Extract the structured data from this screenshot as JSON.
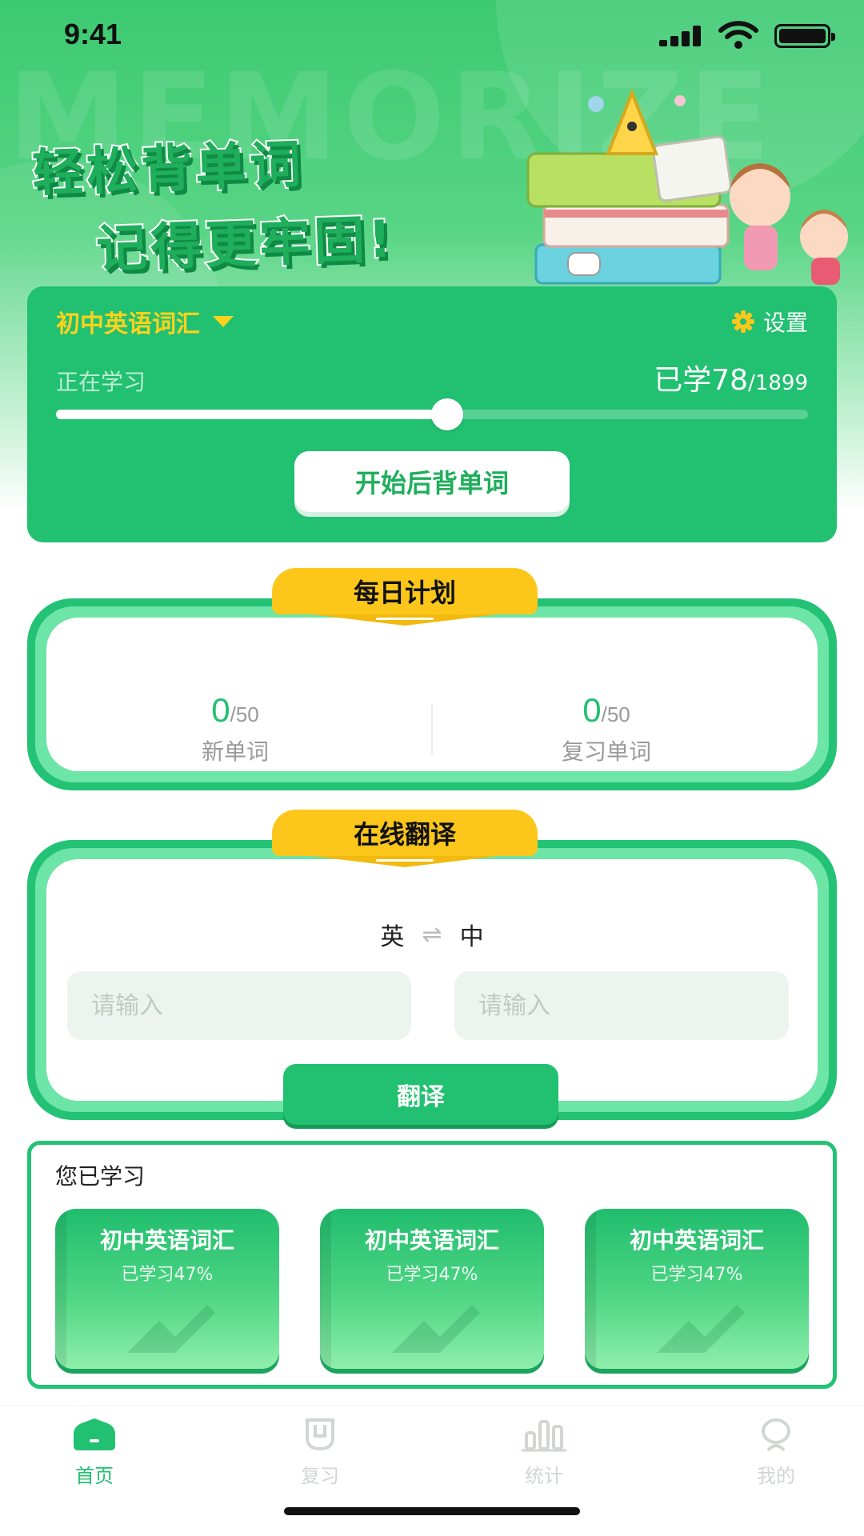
{
  "status_bar": {
    "time": "9:41"
  },
  "hero": {
    "watermark": "MEMORIZE",
    "slogan_line1": "轻松背单词",
    "slogan_line2": "记得更牢固!"
  },
  "vocab_card": {
    "book_name": "初中英语词汇",
    "settings_label": "设置",
    "studying_label": "正在学习",
    "learned_prefix": "已学",
    "learned_count": "78",
    "total_count": "/1899",
    "progress_fraction": 0.52,
    "start_button": "开始后背单词"
  },
  "daily_plan": {
    "title": "每日计划",
    "new_words": {
      "value": "0",
      "target": "/50",
      "label": "新单词"
    },
    "review_words": {
      "value": "0",
      "target": "/50",
      "label": "复习单词"
    }
  },
  "translate": {
    "title": "在线翻译",
    "source_lang": "英",
    "swap_symbol": "⇌",
    "target_lang": "中",
    "input_left_placeholder": "请输入",
    "input_right_placeholder": "请输入",
    "button": "翻译"
  },
  "learned_section": {
    "title": "您已学习",
    "books": [
      {
        "name": "初中英语词汇",
        "progress": "已学习47%"
      },
      {
        "name": "初中英语词汇",
        "progress": "已学习47%"
      },
      {
        "name": "初中英语词汇",
        "progress": "已学习47%"
      }
    ]
  },
  "tab_bar": {
    "active_color": "#22c071",
    "inactive_color": "#d2d6d3",
    "tabs": [
      {
        "label": "首页",
        "icon": "home-icon",
        "active": true
      },
      {
        "label": "复习",
        "icon": "review-icon",
        "active": false
      },
      {
        "label": "统计",
        "icon": "stats-icon",
        "active": false
      },
      {
        "label": "我的",
        "icon": "profile-icon",
        "active": false
      }
    ]
  },
  "colors": {
    "primary": "#22c071",
    "accent": "#fcc71a"
  }
}
